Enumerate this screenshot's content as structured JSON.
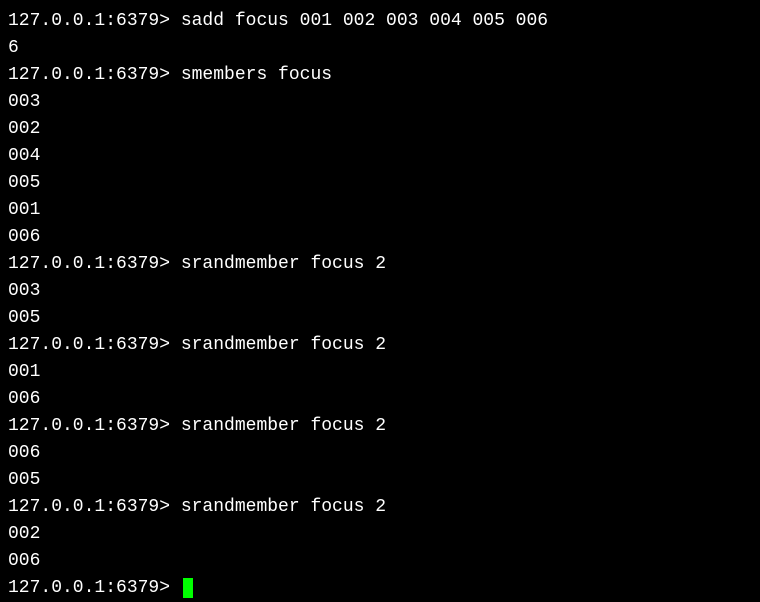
{
  "prompt": "127.0.0.1:6379> ",
  "lines": {
    "l0": "sadd focus 001 002 003 004 005 006",
    "l1": "6",
    "l2": "smembers focus",
    "l3": "003",
    "l4": "002",
    "l5": "004",
    "l6": "005",
    "l7": "001",
    "l8": "006",
    "l9": "srandmember focus 2",
    "l10": "003",
    "l11": "005",
    "l12": "srandmember focus 2",
    "l13": "001",
    "l14": "006",
    "l15": "srandmember focus 2",
    "l16": "006",
    "l17": "005",
    "l18": "srandmember focus 2",
    "l19": "002",
    "l20": "006"
  }
}
